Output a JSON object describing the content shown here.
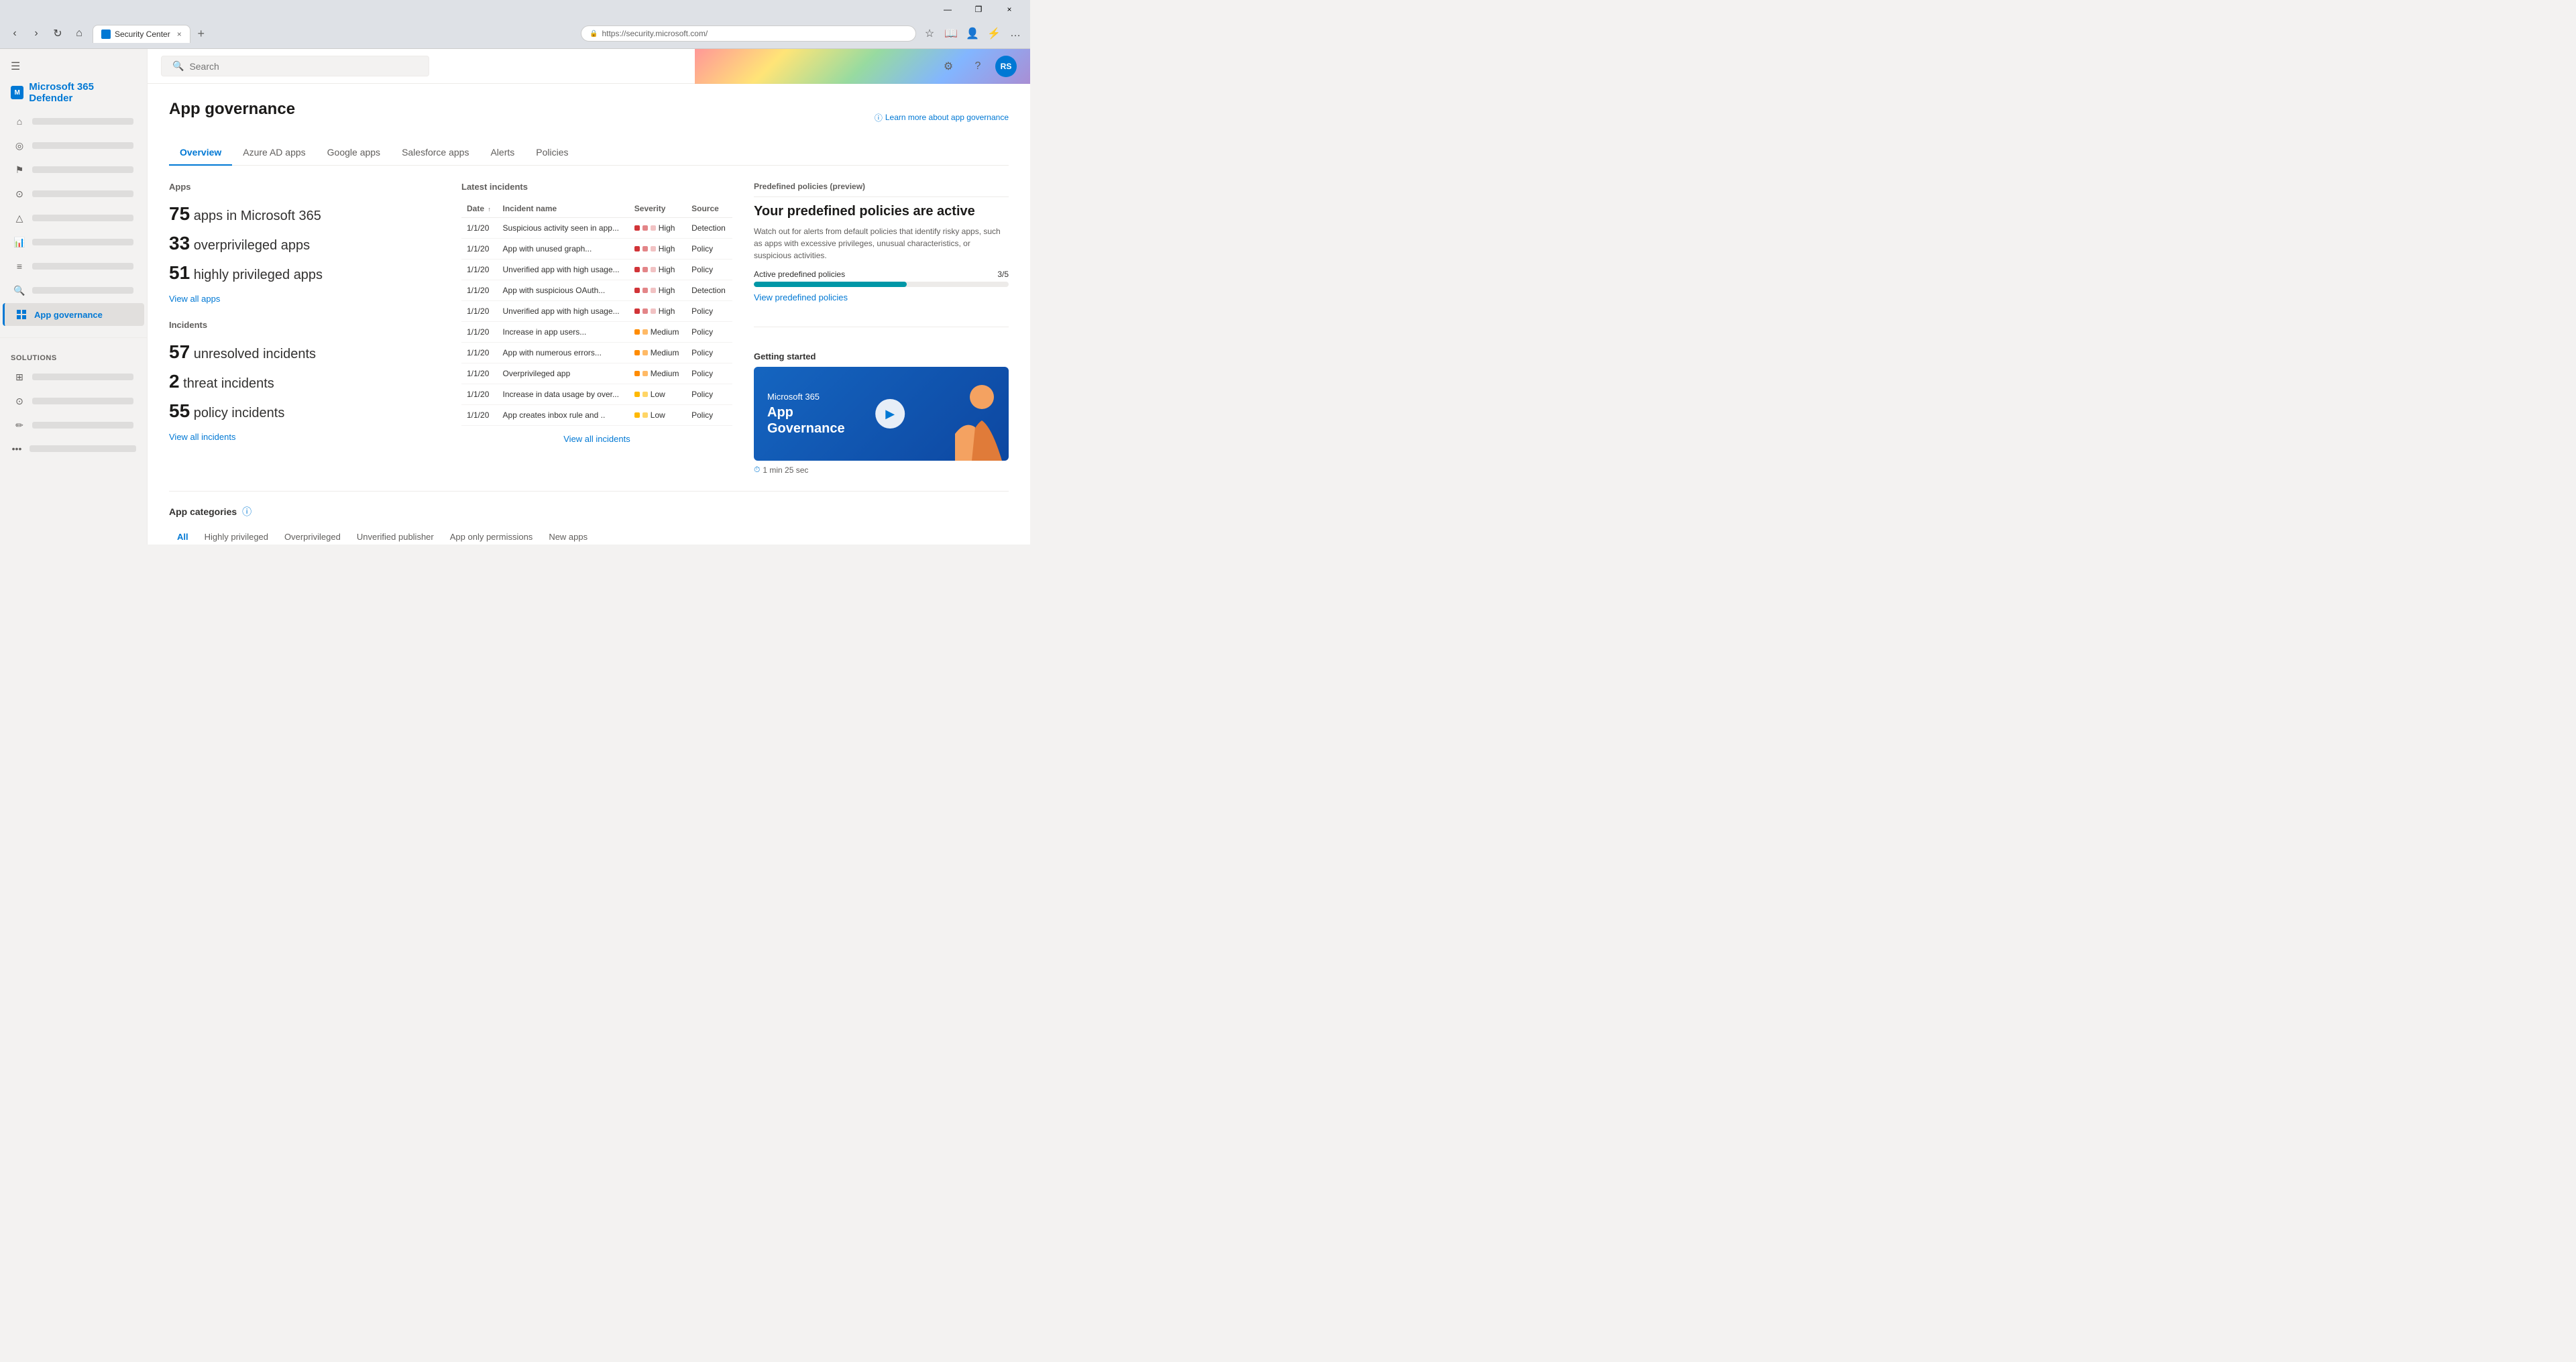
{
  "browser": {
    "tab_title": "Security Center",
    "tab_close": "×",
    "new_tab": "+",
    "address": "https://security.microsoft.com/",
    "title_min": "—",
    "title_restore": "❐",
    "title_close": "×"
  },
  "header": {
    "brand": "Microsoft 365 Defender",
    "search_placeholder": "Search",
    "settings_icon": "⚙",
    "help_icon": "?",
    "avatar": "RS",
    "learn_more": "Learn more about app governance"
  },
  "sidebar": {
    "hamburger": "☰",
    "nav_items": [
      {
        "id": "home",
        "icon": "⌂",
        "label": ""
      },
      {
        "id": "threats",
        "icon": "◎",
        "label": ""
      },
      {
        "id": "incidents",
        "icon": "⚑",
        "label": ""
      },
      {
        "id": "hunting",
        "icon": "⚉",
        "label": ""
      },
      {
        "id": "alerts",
        "icon": "△",
        "label": ""
      },
      {
        "id": "reports",
        "icon": "📈",
        "label": ""
      },
      {
        "id": "config",
        "icon": "≡",
        "label": ""
      },
      {
        "id": "search2",
        "icon": "🔍",
        "label": ""
      }
    ],
    "app_governance_label": "App governance",
    "solutions_label": "Solutions",
    "solutions_items": [
      {
        "id": "sol1",
        "icon": "⊞",
        "label": ""
      },
      {
        "id": "sol2",
        "icon": "⊙",
        "label": ""
      },
      {
        "id": "sol3",
        "icon": "✏",
        "label": ""
      }
    ],
    "more_label": "..."
  },
  "page": {
    "title": "App governance",
    "tabs": [
      {
        "id": "overview",
        "label": "Overview",
        "active": true
      },
      {
        "id": "azure",
        "label": "Azure AD apps",
        "active": false
      },
      {
        "id": "google",
        "label": "Google apps",
        "active": false
      },
      {
        "id": "salesforce",
        "label": "Salesforce apps",
        "active": false
      },
      {
        "id": "alerts",
        "label": "Alerts",
        "active": false
      },
      {
        "id": "policies",
        "label": "Policies",
        "active": false
      }
    ]
  },
  "apps_section": {
    "title": "Apps",
    "stats": [
      {
        "number": "75",
        "label": "apps in Microsoft 365"
      },
      {
        "number": "33",
        "label": "overprivileged apps"
      },
      {
        "number": "51",
        "label": "highly privileged apps"
      }
    ],
    "view_all_link": "View all apps"
  },
  "incidents_section": {
    "title": "Incidents",
    "stats": [
      {
        "number": "57",
        "label": "unresolved incidents"
      },
      {
        "number": "2",
        "label": "threat incidents"
      },
      {
        "number": "55",
        "label": "policy incidents"
      }
    ],
    "view_all_link": "View all incidents"
  },
  "latest_incidents": {
    "title": "Latest incidents",
    "columns": [
      {
        "id": "date",
        "label": "Date",
        "sortable": true
      },
      {
        "id": "name",
        "label": "Incident name",
        "sortable": false
      },
      {
        "id": "severity",
        "label": "Severity",
        "sortable": false
      },
      {
        "id": "source",
        "label": "Source",
        "sortable": false
      }
    ],
    "rows": [
      {
        "date": "1/1/20",
        "name": "Suspicious activity seen in app...",
        "severity": "High",
        "sev_level": "high",
        "source": "Detection"
      },
      {
        "date": "1/1/20",
        "name": "App with unused graph...",
        "severity": "High",
        "sev_level": "high",
        "source": "Policy"
      },
      {
        "date": "1/1/20",
        "name": "Unverified app with high usage...",
        "severity": "High",
        "sev_level": "high",
        "source": "Policy"
      },
      {
        "date": "1/1/20",
        "name": "App with suspicious OAuth...",
        "severity": "High",
        "sev_level": "high",
        "source": "Detection"
      },
      {
        "date": "1/1/20",
        "name": "Unverified app with high usage...",
        "severity": "High",
        "sev_level": "high",
        "source": "Policy"
      },
      {
        "date": "1/1/20",
        "name": "Increase in app users...",
        "severity": "Medium",
        "sev_level": "medium",
        "source": "Policy"
      },
      {
        "date": "1/1/20",
        "name": "App with numerous errors...",
        "severity": "Medium",
        "sev_level": "medium",
        "source": "Policy"
      },
      {
        "date": "1/1/20",
        "name": "Overprivileged app",
        "severity": "Medium",
        "sev_level": "medium",
        "source": "Policy"
      },
      {
        "date": "1/1/20",
        "name": "Increase in data usage by over...",
        "severity": "Low",
        "sev_level": "low",
        "source": "Policy"
      },
      {
        "date": "1/1/20",
        "name": "App creates inbox rule and ..",
        "severity": "Low",
        "sev_level": "low",
        "source": "Policy"
      }
    ],
    "view_all_link": "View all incidents"
  },
  "predefined_policies": {
    "section_title": "Predefined policies (preview)",
    "heading": "Your predefined policies are active",
    "description": "Watch out for alerts from default policies that identify risky apps, such as apps with excessive privileges, unusual characteristics, or suspicious activities.",
    "progress_label": "Active predefined policies",
    "progress_value": "3/5",
    "progress_percent": 60,
    "view_link": "View predefined policies"
  },
  "getting_started": {
    "title": "Getting started",
    "video_ms": "Microsoft 365",
    "video_app": "App\nGovernance",
    "play_label": "▶",
    "duration_icon": "⏱",
    "duration": "1 min 25 sec"
  },
  "app_categories": {
    "title": "App categories",
    "info_icon": "ℹ",
    "tabs": [
      {
        "id": "all",
        "label": "All",
        "active": true
      },
      {
        "id": "highly",
        "label": "Highly privileged",
        "active": false
      },
      {
        "id": "over",
        "label": "Overprivileged",
        "active": false
      },
      {
        "id": "unverified",
        "label": "Unverified publisher",
        "active": false
      },
      {
        "id": "apponly",
        "label": "App only permissions",
        "active": false
      },
      {
        "id": "newapps",
        "label": "New apps",
        "active": false
      }
    ]
  }
}
